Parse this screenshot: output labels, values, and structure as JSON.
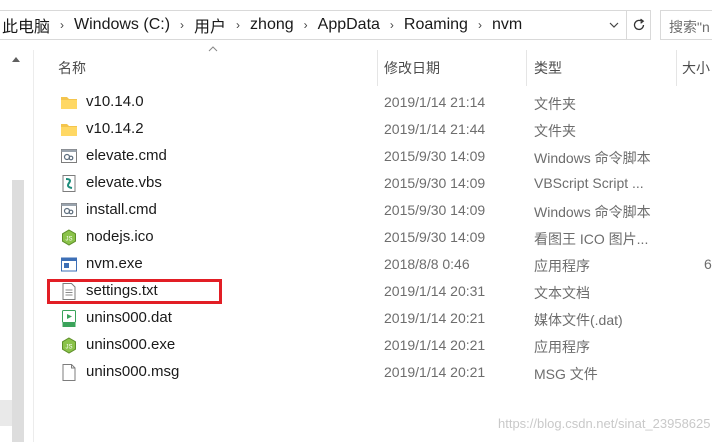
{
  "address": {
    "breadcrumbs": [
      "此电脑",
      "Windows (C:)",
      "用户",
      "zhong",
      "AppData",
      "Roaming",
      "nvm"
    ],
    "separator": "›",
    "dropdown_icon": "chevron-down-icon",
    "refresh_icon": "refresh-icon"
  },
  "search": {
    "placeholder": "搜索\"nvm\"",
    "shown_text": "搜索\"n"
  },
  "columns": {
    "name": "名称",
    "date": "修改日期",
    "type": "类型",
    "size": "大小"
  },
  "files": [
    {
      "name": "v10.14.0",
      "date": "2019/1/14 21:14",
      "type": "文件夹",
      "size": "",
      "icon": "folder-icon"
    },
    {
      "name": "v10.14.2",
      "date": "2019/1/14 21:44",
      "type": "文件夹",
      "size": "",
      "icon": "folder-icon"
    },
    {
      "name": "elevate.cmd",
      "date": "2015/9/30 14:09",
      "type": "Windows 命令脚本",
      "size": "",
      "icon": "cmd-script-icon"
    },
    {
      "name": "elevate.vbs",
      "date": "2015/9/30 14:09",
      "type": "VBScript Script ...",
      "size": "",
      "icon": "vbs-script-icon"
    },
    {
      "name": "install.cmd",
      "date": "2015/9/30 14:09",
      "type": "Windows 命令脚本",
      "size": "",
      "icon": "cmd-script-icon"
    },
    {
      "name": "nodejs.ico",
      "date": "2015/9/30 14:09",
      "type": "看图王 ICO 图片...",
      "size": "",
      "icon": "nodejs-icon"
    },
    {
      "name": "nvm.exe",
      "date": "2018/8/8 0:46",
      "type": "应用程序",
      "size": "6",
      "icon": "exe-window-icon"
    },
    {
      "name": "settings.txt",
      "date": "2019/1/14 20:31",
      "type": "文本文档",
      "size": "",
      "icon": "text-document-icon"
    },
    {
      "name": "unins000.dat",
      "date": "2019/1/14 20:21",
      "type": "媒体文件(.dat)",
      "size": "",
      "icon": "media-file-icon"
    },
    {
      "name": "unins000.exe",
      "date": "2019/1/14 20:21",
      "type": "应用程序",
      "size": "",
      "icon": "nodejs-installer-icon"
    },
    {
      "name": "unins000.msg",
      "date": "2019/1/14 20:21",
      "type": "MSG 文件",
      "size": "",
      "icon": "blank-file-icon"
    }
  ],
  "highlight": {
    "color": "#e21e25",
    "target": "settings.txt"
  },
  "watermark": "https://blog.csdn.net/sinat_23958625"
}
